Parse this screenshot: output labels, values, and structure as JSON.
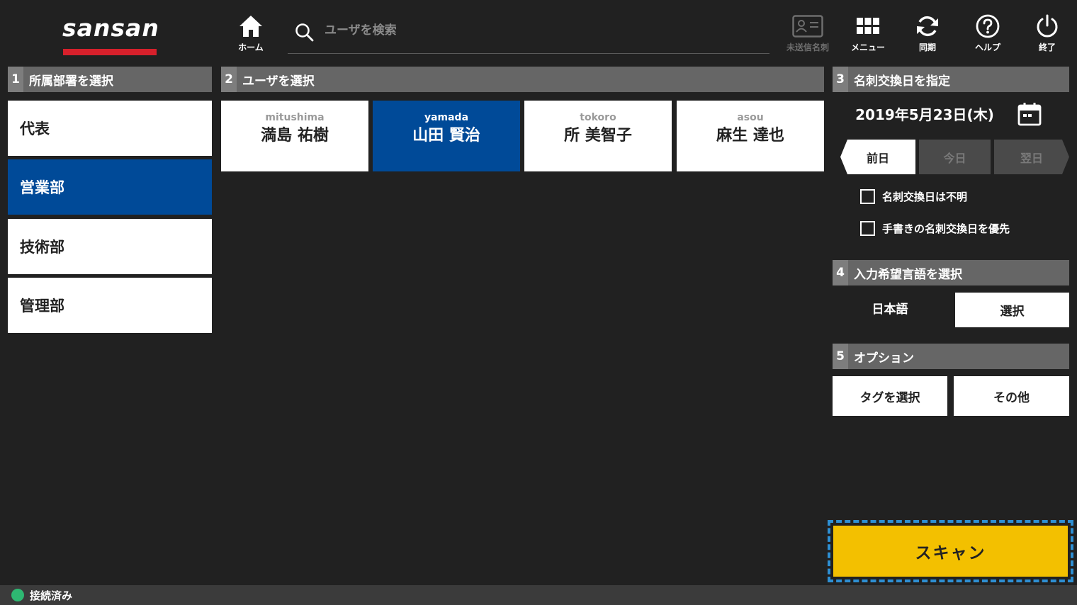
{
  "header": {
    "logo_text": "sansan",
    "home_label": "ホーム",
    "search_placeholder": "ユーザを検索",
    "unsent_label": "未送信名刺",
    "menu_label": "メニュー",
    "sync_label": "同期",
    "help_label": "ヘルプ",
    "exit_label": "終了"
  },
  "sections": {
    "dept": {
      "num": "1",
      "title": "所属部署を選択"
    },
    "user": {
      "num": "2",
      "title": "ユーザを選択"
    },
    "date": {
      "num": "3",
      "title": "名刺交換日を指定"
    },
    "lang": {
      "num": "4",
      "title": "入力希望言語を選択"
    },
    "option": {
      "num": "5",
      "title": "オプション"
    }
  },
  "departments": [
    {
      "label": "代表",
      "selected": false
    },
    {
      "label": "営業部",
      "selected": true
    },
    {
      "label": "技術部",
      "selected": false
    },
    {
      "label": "管理部",
      "selected": false
    }
  ],
  "users": [
    {
      "romaji": "mitushima",
      "name": "満島 祐樹",
      "selected": false
    },
    {
      "romaji": "yamada",
      "name": "山田 賢治",
      "selected": true
    },
    {
      "romaji": "tokoro",
      "name": "所 美智子",
      "selected": false
    },
    {
      "romaji": "asou",
      "name": "麻生 達也",
      "selected": false
    }
  ],
  "date": {
    "value": "2019年5月23日(木)",
    "prev_label": "前日",
    "today_label": "今日",
    "next_label": "翌日",
    "unknown_label": "名刺交換日は不明",
    "prefer_handwritten_label": "手書きの名刺交換日を優先"
  },
  "language": {
    "current": "日本語",
    "select_label": "選択"
  },
  "options": {
    "tag_label": "タグを選択",
    "other_label": "その他"
  },
  "scan_label": "スキャン",
  "status": {
    "text": "接続済み",
    "color": "#2eb872"
  },
  "colors": {
    "accent": "#004a98",
    "scan": "#f3c000",
    "logo_bar": "#d7202b"
  }
}
